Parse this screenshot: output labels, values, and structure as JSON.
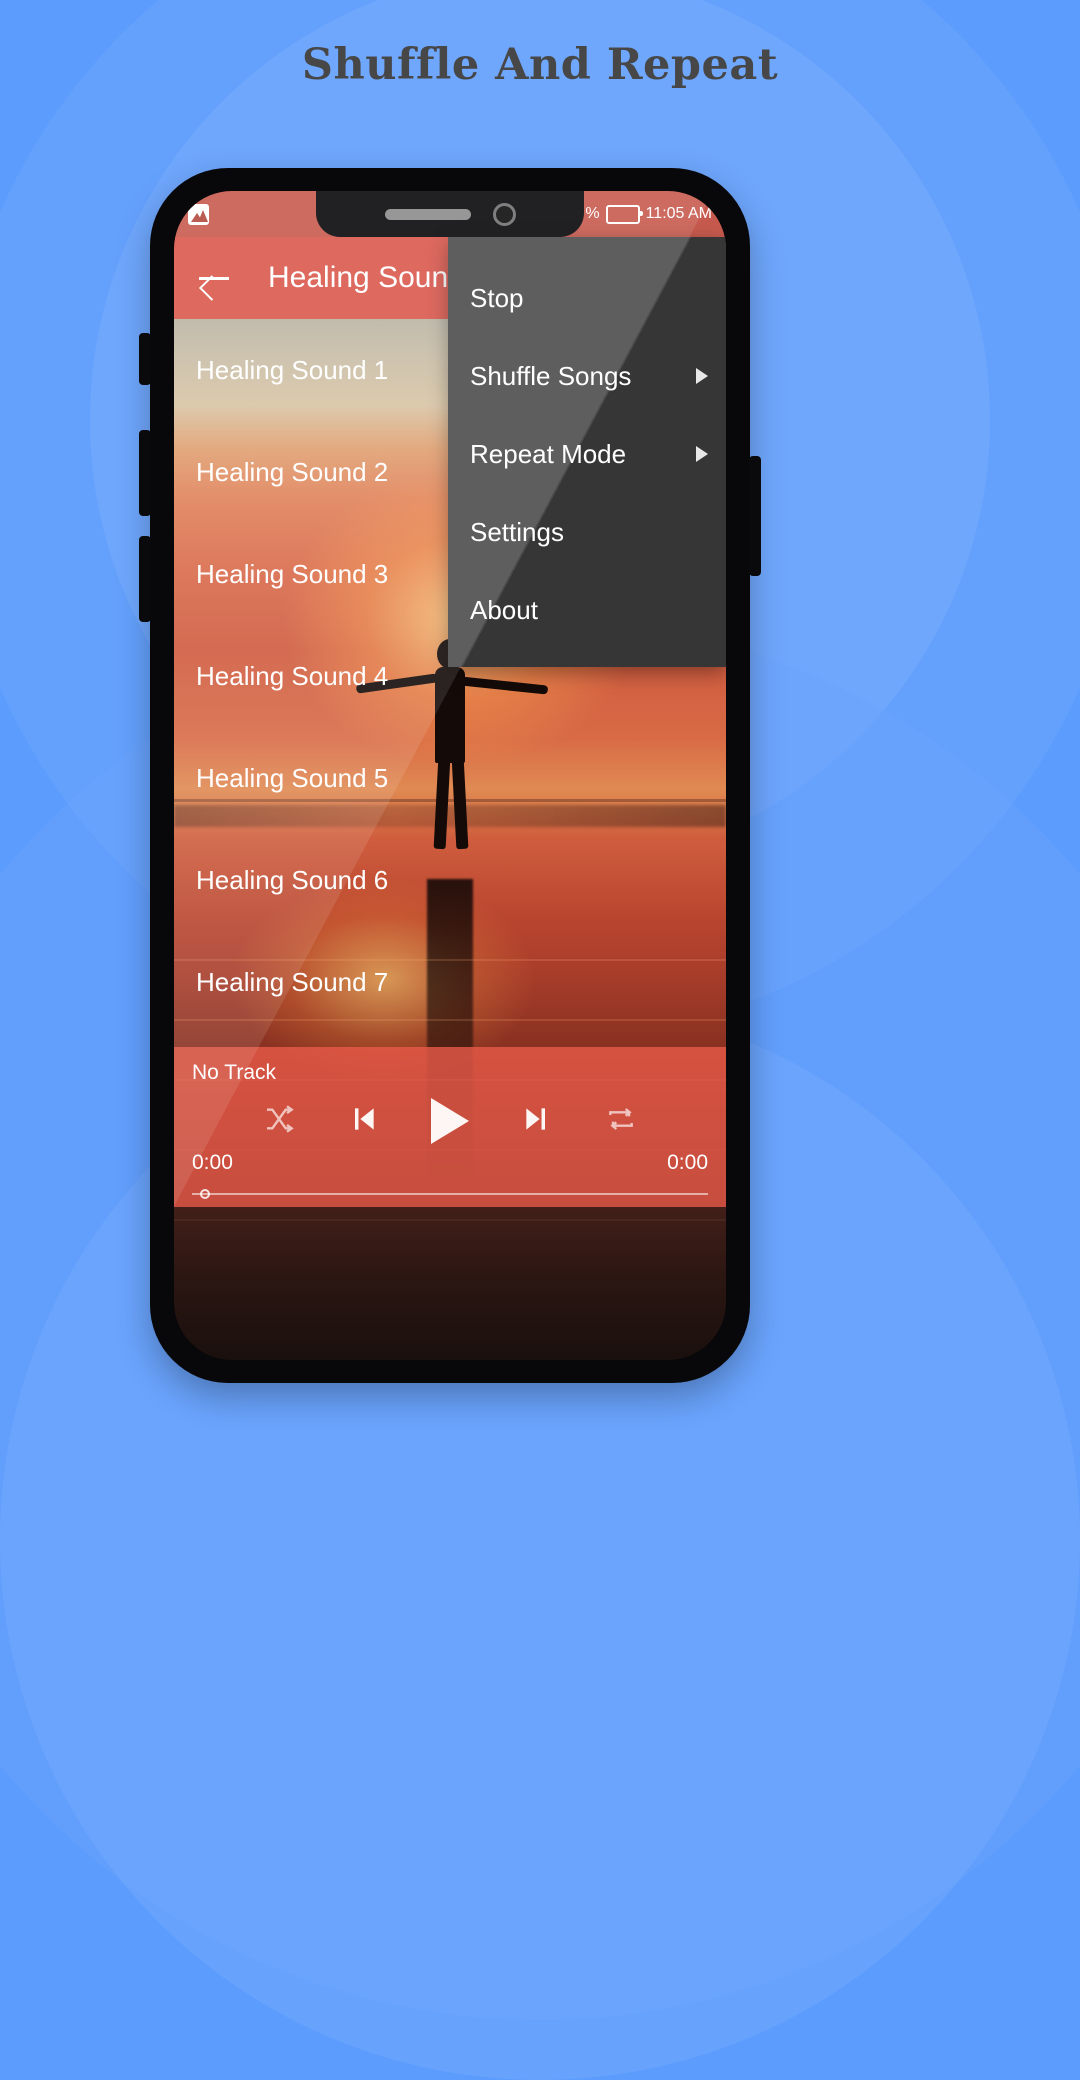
{
  "page": {
    "title": "Shuffle And Repeat"
  },
  "colors": {
    "background": "#5c9cfd",
    "title_text": "#474747",
    "appbar": "#d9584d",
    "statusbar": "#c75a4e",
    "menu_bg": "#3e3e3e",
    "player_bg": "#e95a49",
    "text_light": "#ffffff"
  },
  "phone": {
    "statusbar": {
      "notification_icon": "photo-icon",
      "battery_percent_label": "%",
      "time": "11:05 AM",
      "battery_icon": "battery-icon"
    },
    "appbar": {
      "back_icon": "back-arrow-icon",
      "title": "Healing Sounds"
    },
    "song_list": [
      {
        "label": "Healing Sound 1"
      },
      {
        "label": "Healing Sound 2"
      },
      {
        "label": "Healing Sound 3"
      },
      {
        "label": "Healing Sound 4"
      },
      {
        "label": "Healing Sound 5"
      },
      {
        "label": "Healing Sound 6"
      },
      {
        "label": "Healing Sound 7"
      }
    ],
    "menu": {
      "items": [
        {
          "label": "Stop",
          "has_submenu": false
        },
        {
          "label": "Shuffle Songs",
          "has_submenu": true
        },
        {
          "label": "Repeat Mode",
          "has_submenu": true
        },
        {
          "label": "Settings",
          "has_submenu": false
        },
        {
          "label": "About",
          "has_submenu": false
        }
      ]
    },
    "player": {
      "track_name": "No Track",
      "elapsed_time": "0:00",
      "total_time": "0:00",
      "controls": {
        "shuffle": "shuffle-icon",
        "previous": "skip-previous-icon",
        "play": "play-icon",
        "next": "skip-next-icon",
        "repeat": "repeat-icon"
      },
      "seek_position_percent": 0
    }
  }
}
